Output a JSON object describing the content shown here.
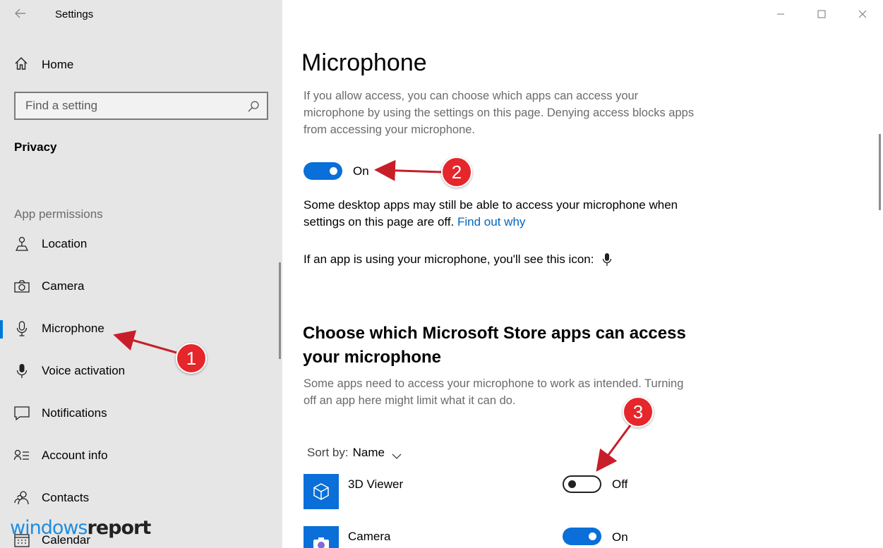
{
  "window": {
    "title": "Settings"
  },
  "sidebar": {
    "home_label": "Home",
    "search_placeholder": "Find a setting",
    "section_title": "Privacy",
    "group_label": "App permissions",
    "items": [
      {
        "label": "Location",
        "icon": "location-icon"
      },
      {
        "label": "Camera",
        "icon": "camera-icon"
      },
      {
        "label": "Microphone",
        "icon": "microphone-icon",
        "selected": true
      },
      {
        "label": "Voice activation",
        "icon": "voice-activation-icon"
      },
      {
        "label": "Notifications",
        "icon": "notifications-icon"
      },
      {
        "label": "Account info",
        "icon": "account-info-icon"
      },
      {
        "label": "Contacts",
        "icon": "contacts-icon"
      },
      {
        "label": "Calendar",
        "icon": "calendar-icon"
      }
    ]
  },
  "main": {
    "title": "Microphone",
    "description": "If you allow access, you can choose which apps can access your microphone by using the settings on this page. Denying access blocks apps from accessing your microphone.",
    "master_toggle": {
      "state": "on",
      "label": "On"
    },
    "desktop_note": "Some desktop apps may still be able to access your microphone when settings on this page are off.",
    "find_out_why": "Find out why",
    "icon_note": "If an app is using your microphone, you'll see this icon:",
    "store_heading": "Choose which Microsoft Store apps can access your microphone",
    "store_desc": "Some apps need to access your microphone to work as intended. Turning off an app here might limit what it can do.",
    "sort_label": "Sort by:",
    "sort_value": "Name",
    "apps": [
      {
        "name": "3D Viewer",
        "toggle": "off",
        "toggle_label": "Off"
      },
      {
        "name": "Camera",
        "toggle": "on",
        "toggle_label": "On"
      }
    ]
  },
  "annotations": {
    "badge_1": "1",
    "badge_2": "2",
    "badge_3": "3"
  },
  "watermark": {
    "part1": "windows",
    "part2": "report"
  },
  "colors": {
    "accent": "#0a6fd8",
    "sidebar_bg": "#e6e6e6",
    "badge": "#e5262b",
    "link": "#0067c0"
  }
}
